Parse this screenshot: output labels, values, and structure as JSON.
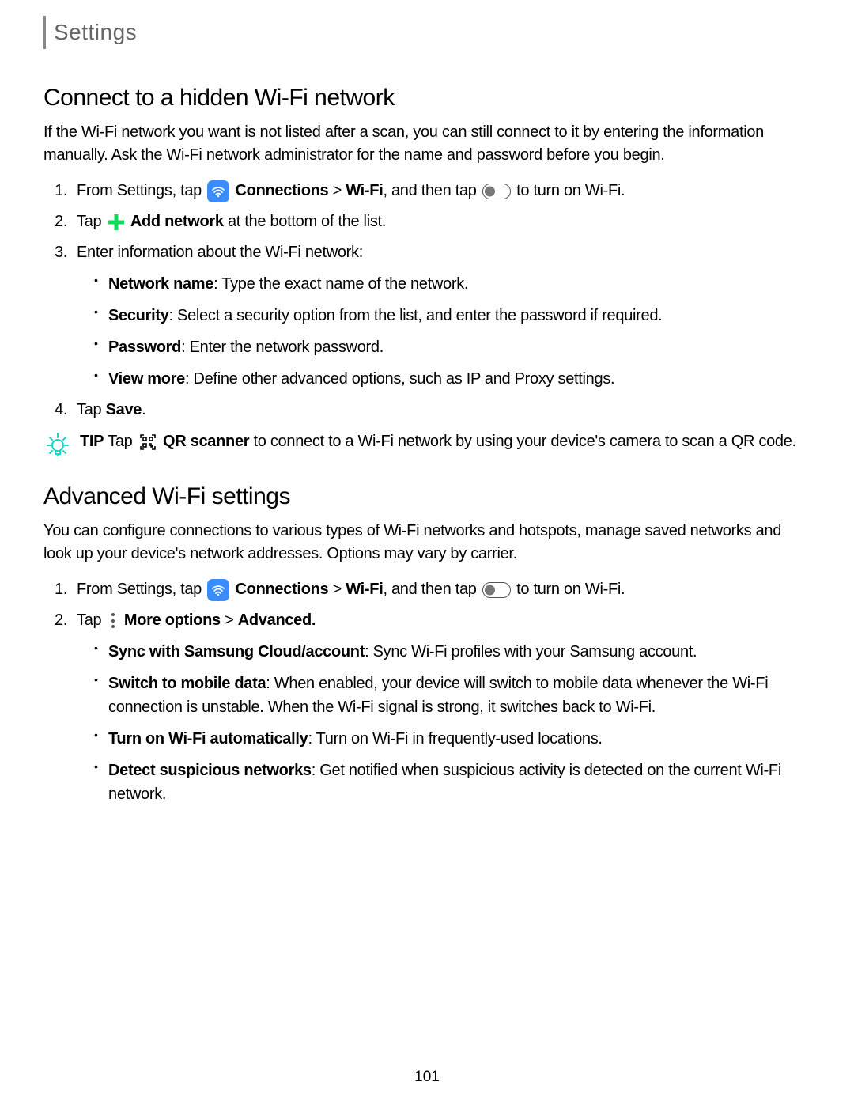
{
  "header": {
    "title": "Settings"
  },
  "section1": {
    "heading": "Connect to a hidden Wi-Fi network",
    "intro": "If the Wi-Fi network you want is not listed after a scan, you can still connect to it by entering the information manually. Ask the Wi-Fi network administrator for the name and password before you begin.",
    "step1": {
      "pre": "From Settings, tap ",
      "connections": "Connections",
      "gt": " > ",
      "wifi": "Wi-Fi",
      "mid": ", and then tap ",
      "post": " to turn on Wi-Fi."
    },
    "step2": {
      "pre": "Tap ",
      "label": "Add network",
      "post": " at the bottom of the list."
    },
    "step3": {
      "text": "Enter information about the Wi-Fi network:",
      "sub1_label": "Network name",
      "sub1_text": ": Type the exact name of the network.",
      "sub2_label": "Security",
      "sub2_text": ": Select a security option from the list, and enter the password if required.",
      "sub3_label": "Password",
      "sub3_text": ": Enter the network password.",
      "sub4_label": "View more",
      "sub4_text": ": Define other advanced options, such as IP and Proxy settings."
    },
    "step4": {
      "pre": "Tap ",
      "label": "Save",
      "post": "."
    },
    "tip": {
      "label": "TIP",
      "pre": "  Tap ",
      "scanner": "QR scanner",
      "post": " to connect to a Wi-Fi network by using your device's camera to scan a QR code."
    }
  },
  "section2": {
    "heading": "Advanced Wi-Fi settings",
    "intro": "You can configure connections to various types of Wi-Fi networks and hotspots, manage saved networks and look up your device's network addresses. Options may vary by carrier.",
    "step1": {
      "pre": "From Settings, tap ",
      "connections": "Connections",
      "gt": " > ",
      "wifi": "Wi-Fi",
      "mid": ", and then tap ",
      "post": " to turn on Wi-Fi."
    },
    "step2": {
      "pre": "Tap ",
      "more": "More options",
      "gt": " > ",
      "advanced": "Advanced.",
      "sub1_label": "Sync with Samsung Cloud/account",
      "sub1_text": ": Sync Wi-Fi profiles with your Samsung account.",
      "sub2_label": "Switch to mobile data",
      "sub2_text": ": When enabled, your device will switch to mobile data whenever the Wi-Fi connection is unstable. When the Wi-Fi signal is strong, it switches back to Wi-Fi.",
      "sub3_label": "Turn on Wi-Fi automatically",
      "sub3_text": ": Turn on Wi-Fi in frequently-used locations.",
      "sub4_label": "Detect suspicious networks",
      "sub4_text": ": Get notified when suspicious activity is detected on the current Wi-Fi network."
    }
  },
  "page_number": "101"
}
